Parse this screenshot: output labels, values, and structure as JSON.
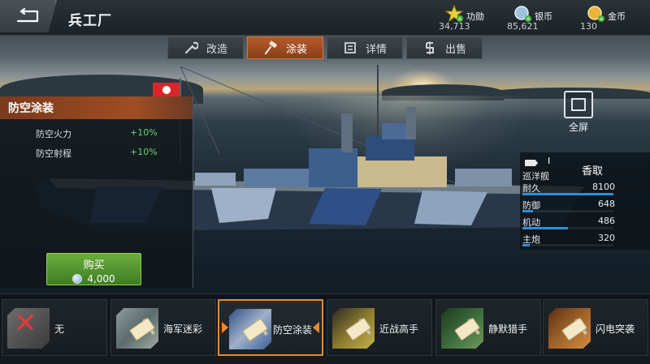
{
  "header": {
    "title": "兵工厂",
    "currencies": [
      {
        "icon": "medal-star-icon",
        "label": "功勋",
        "value": "34,713",
        "color": "#e8d23a"
      },
      {
        "icon": "silver-coin-icon",
        "label": "银币",
        "value": "85,621",
        "color": "#9fc2dc"
      },
      {
        "icon": "gold-coin-icon",
        "label": "金币",
        "value": "130",
        "color": "#e8b43a"
      }
    ]
  },
  "tabs": [
    {
      "label": "改造",
      "icon": "wrench-icon",
      "active": false
    },
    {
      "label": "涂装",
      "icon": "paint-roller-icon",
      "active": true
    },
    {
      "label": "详情",
      "icon": "details-icon",
      "active": false
    },
    {
      "label": "出售",
      "icon": "sell-icon",
      "active": false
    }
  ],
  "paint_info": {
    "title": "防空涂装",
    "stats": [
      {
        "name": "防空火力",
        "value": "+10%"
      },
      {
        "name": "防空射程",
        "value": "+10%"
      }
    ],
    "buy": {
      "label": "购买",
      "price": "4,000",
      "currency_icon": "silver-coin-icon"
    }
  },
  "fullscreen": {
    "label": "全屏"
  },
  "ship": {
    "tier": "I",
    "class": "巡洋舰",
    "name": "香取",
    "stats": [
      {
        "name": "耐久",
        "value": "8100",
        "level": 1.0
      },
      {
        "name": "防御",
        "value": "648",
        "level": 0.12
      },
      {
        "name": "机动",
        "value": "486",
        "level": 0.5
      },
      {
        "name": "主炮",
        "value": "320",
        "level": 0.08
      }
    ]
  },
  "paints": [
    {
      "name": "无",
      "icon": "no-paint-icon",
      "selected": false,
      "swatch": "#5a5a5a"
    },
    {
      "name": "海军迷彩",
      "icon": "navy-camo-icon",
      "selected": false,
      "swatch": "#7c8a8c"
    },
    {
      "name": "防空涂装",
      "icon": "aa-camo-icon",
      "selected": true,
      "swatch": "#3b5f9a"
    },
    {
      "name": "近战高手",
      "icon": "melee-camo-icon",
      "selected": false,
      "swatch": "#8a7a2e"
    },
    {
      "name": "静默猎手",
      "icon": "silent-hunter-camo-icon",
      "selected": false,
      "swatch": "#3c6a3c"
    },
    {
      "name": "闪电突袭",
      "icon": "lightning-raid-camo-icon",
      "selected": false,
      "swatch": "#a0632a"
    }
  ]
}
